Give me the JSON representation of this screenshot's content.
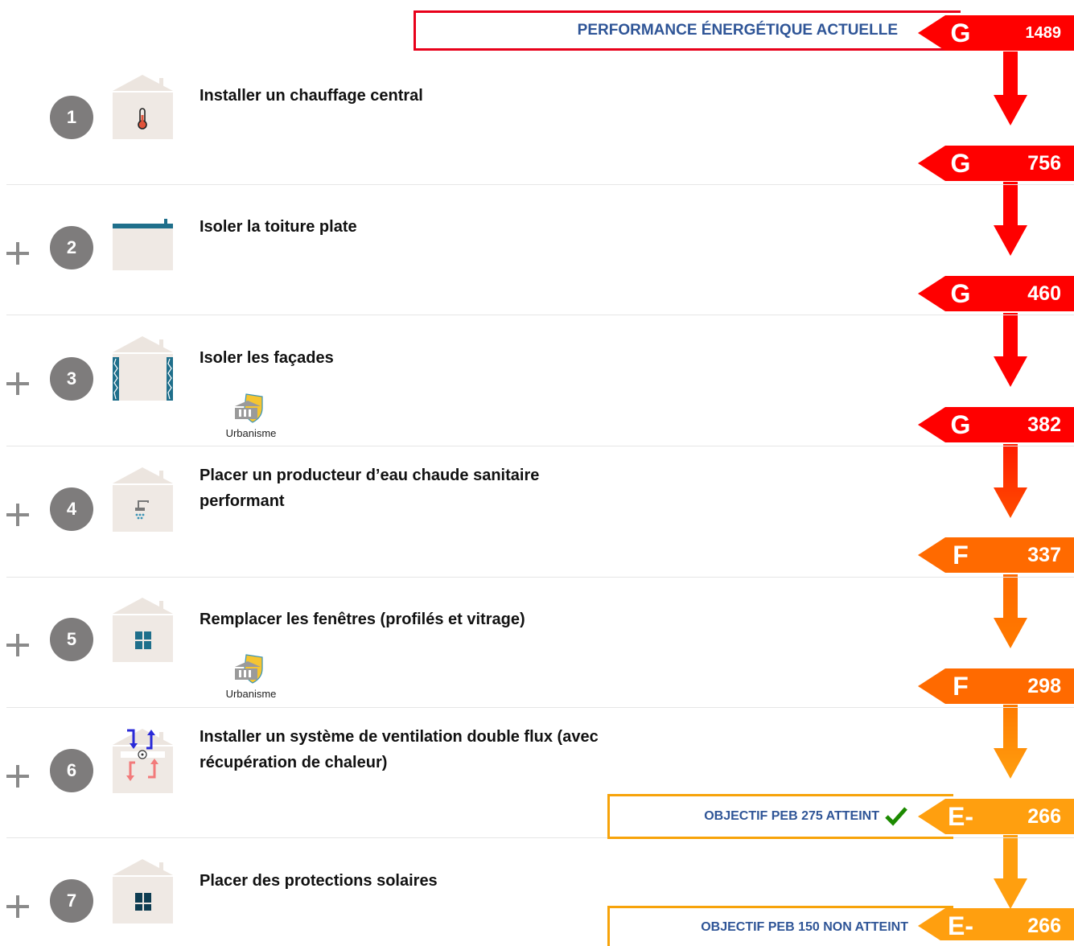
{
  "colors": {
    "G": "#ff0000",
    "G_light": "#ff2a00",
    "F": "#ff6a00",
    "E": "#ff9f0f",
    "banner_red": "#e8001a",
    "banner_orange": "#f7a30a",
    "title_blue": "#2f5597",
    "check_green": "#1c8a00",
    "circle_grey": "#7e7c7c"
  },
  "header": {
    "banner": "PERFORMANCE ÉNERGÉTIQUE ACTUELLE",
    "label": "G",
    "value": "1489"
  },
  "steps": [
    {
      "number": "1",
      "plus": false,
      "title": "Installer un chauffage central",
      "icon": "thermometer-icon"
    },
    {
      "number": "2",
      "plus": true,
      "title": "Isoler la toiture plate",
      "icon": "flat-roof-icon"
    },
    {
      "number": "3",
      "plus": true,
      "title": "Isoler les façades",
      "icon": "facade-insulation-icon",
      "urbanisme": "Urbanisme"
    },
    {
      "number": "4",
      "plus": true,
      "title": "Placer un producteur d’eau chaude sanitaire performant",
      "icon": "shower-icon"
    },
    {
      "number": "5",
      "plus": true,
      "title": "Remplacer les fenêtres (profilés et vitrage)",
      "icon": "window-icon",
      "urbanisme": "Urbanisme"
    },
    {
      "number": "6",
      "plus": true,
      "title": "Installer un système de ventilation double flux (avec récupération de chaleur)",
      "icon": "ventilation-icon"
    },
    {
      "number": "7",
      "plus": true,
      "title": "Placer des protections solaires",
      "icon": "sun-protection-icon"
    }
  ],
  "results": [
    {
      "label": "G",
      "value": "756"
    },
    {
      "label": "G",
      "value": "460"
    },
    {
      "label": "G",
      "value": "382"
    },
    {
      "label": "F",
      "value": "337"
    },
    {
      "label": "F",
      "value": "298"
    },
    {
      "label": "E-",
      "value": "266",
      "banner": "OBJECTIF PEB 275 ATTEINT"
    },
    {
      "label": "E-",
      "value": "266",
      "banner": "OBJECTIF PEB 150 NON ATTEINT"
    }
  ]
}
